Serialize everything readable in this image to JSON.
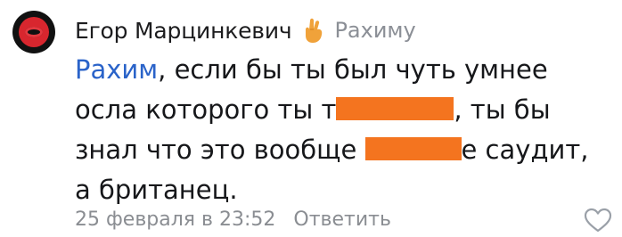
{
  "comment": {
    "author": "Егор Марцинкевич",
    "author_emoji": "crossed-fingers-emoji",
    "reply_to": "Рахиму",
    "mention": "Рахим",
    "lines": {
      "l1_rest": ", если бы ты был чуть умнее",
      "l2_start": "осла которого ты т",
      "l2_end": ", ты бы",
      "l3_start": "знал что это вообще ",
      "l3_end": "е саудит,",
      "l4": "а британец."
    },
    "date": "25 февраля в 23:52",
    "reply_label": "Ответить"
  },
  "colors": {
    "mention": "#2a63c9",
    "muted": "#8a8d92",
    "redaction": "#f4741f"
  },
  "icons": {
    "like": "heart-outline-icon"
  }
}
